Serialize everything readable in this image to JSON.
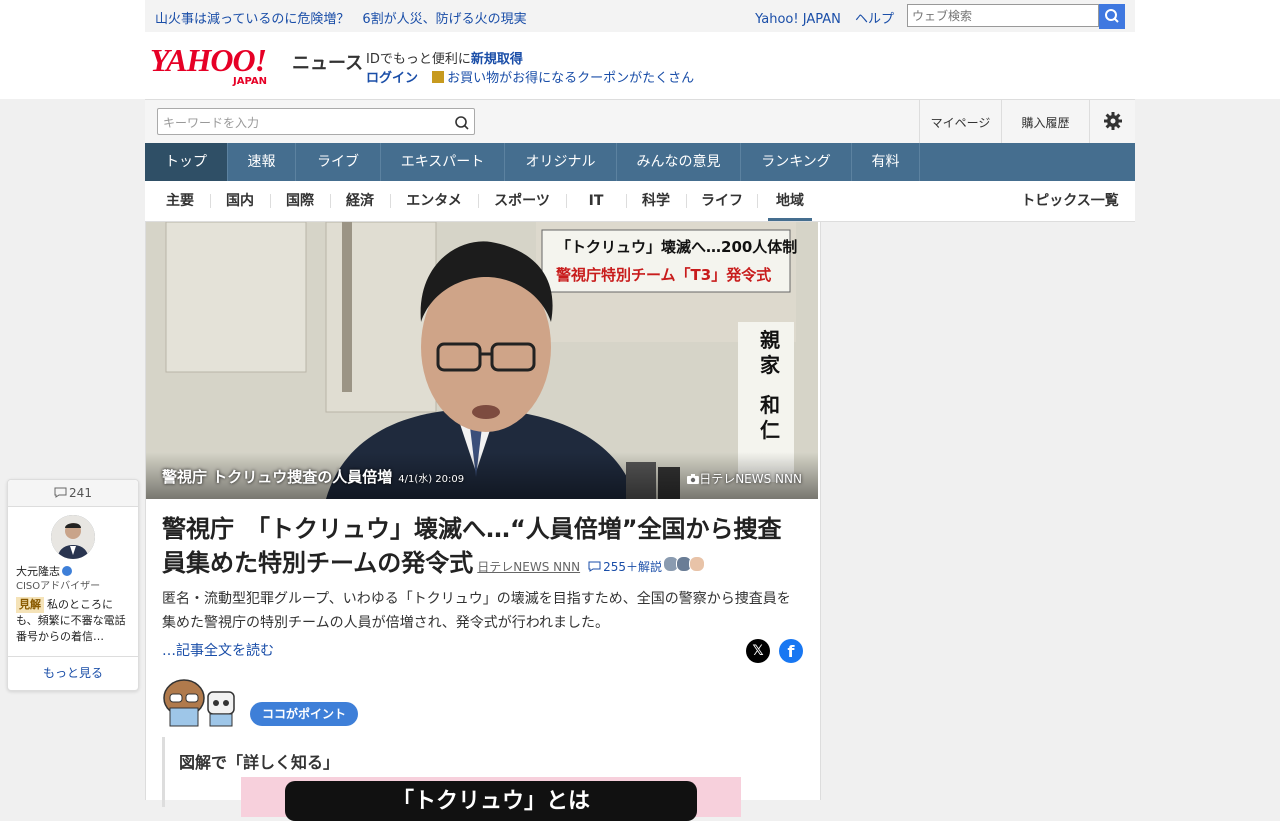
{
  "topbar": {
    "headline": "山火事は減っているのに危険増？　6割が人災、防げる火の現実",
    "links": [
      "Yahoo! JAPAN",
      "ヘルプ"
    ],
    "search_placeholder": "ウェブ検索"
  },
  "header": {
    "logo_main": "YAHOO!",
    "logo_sub": "JAPAN",
    "service": "ニュース",
    "id_text": "IDでもっと便利に",
    "id_link": "新規取得",
    "login": "ログイン",
    "coupon": "お買い物がお得になるクーポンがたくさん"
  },
  "searchbar": {
    "placeholder": "キーワードを入力",
    "mypage": "マイページ",
    "history": "購入履歴",
    "settings_icon": "gear-icon"
  },
  "global_nav": [
    "トップ",
    "速報",
    "ライブ",
    "エキスパート",
    "オリジナル",
    "みんなの意見",
    "ランキング",
    "有料"
  ],
  "sub_nav": [
    "主要",
    "国内",
    "国際",
    "経済",
    "エンタメ",
    "スポーツ",
    "IT",
    "科学",
    "ライフ",
    "地域"
  ],
  "topics_list": "トピックス一覧",
  "article": {
    "photo_caption": "警視庁 トクリュウ捜査の人員倍増",
    "photo_date": "4/1(水) 20:09",
    "photo_credit": "日テレNEWS NNN",
    "title": "警視庁　「トクリュウ」壊滅へ…“人員倍増”全国から捜査員集めた特別チームの発令式",
    "source": "日テレNEWS NNN",
    "comments": "255＋解説",
    "summary": "匿名・流動型犯罪グループ、いわゆる「トクリュウ」の壊滅を目指すため、全国の警察から捜査員を集めた警視庁の特別チームの人員が倍増され、発令式が行われました。",
    "read_more": "…記事全文を読む",
    "point_label": "ココがポイント",
    "figure_heading": "図解で「詳しく知る」",
    "figure_banner": "「トクリュウ」とは"
  },
  "expert_card": {
    "comment_count": "241",
    "name": "大元隆志",
    "role": "CISOアドバイザー",
    "tag": "見解",
    "text": "私のところにも、頻繁に不審な電話番号からの着信…",
    "more": "もっと見る"
  },
  "colors": {
    "nav": "#456e8f",
    "link": "#1a4ea8",
    "brand_red": "#e60026"
  }
}
